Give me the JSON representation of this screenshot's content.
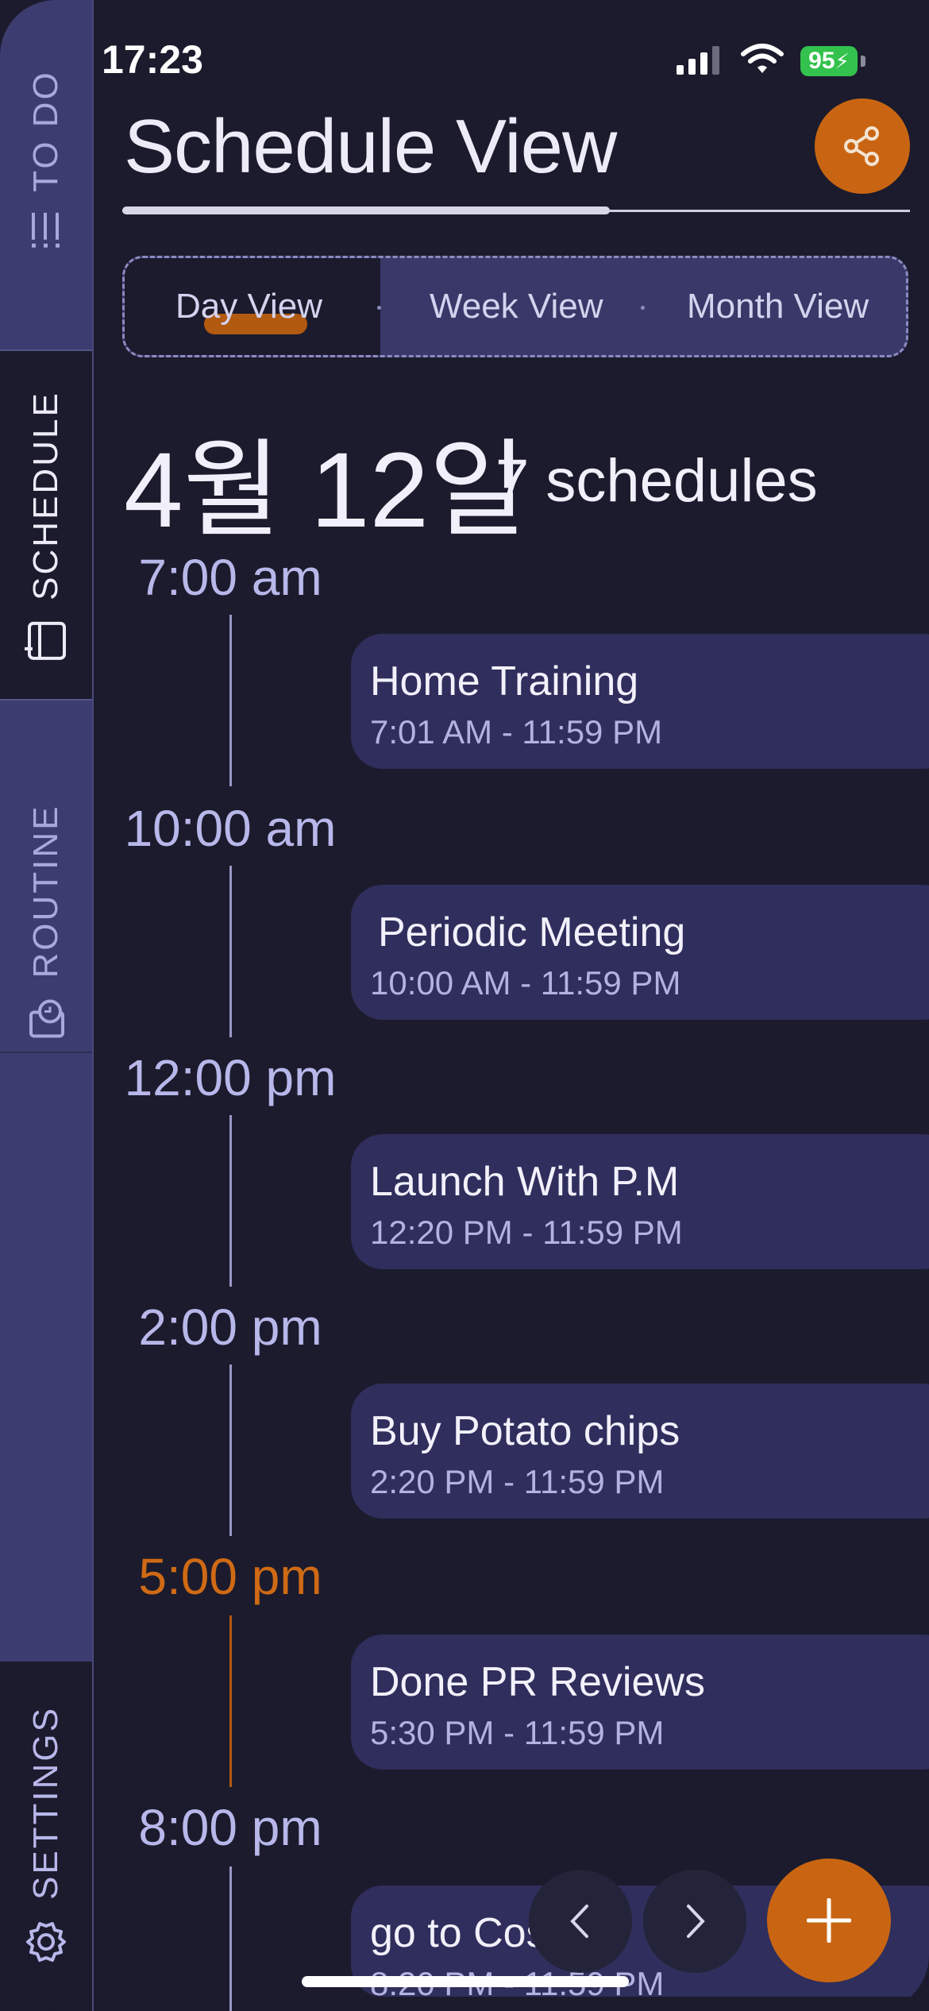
{
  "status": {
    "time": "17:23",
    "battery": "95"
  },
  "sidebar": {
    "todo": {
      "label": "TO DO",
      "icon": "list-icon"
    },
    "schedule": {
      "label": "SCHEDULE",
      "icon": "calendar-icon"
    },
    "routine": {
      "label": "ROUTINE",
      "icon": "routine-clock-icon"
    },
    "settings": {
      "label": "SETTINGS",
      "icon": "gear-icon"
    }
  },
  "header": {
    "title": "Schedule View",
    "share_icon": "share-icon"
  },
  "views": {
    "day": "Day View",
    "week": "Week View",
    "month": "Month View",
    "selected": "Day View"
  },
  "date": {
    "label": "4월 12일",
    "count": "7 schedules"
  },
  "timeline": [
    {
      "time": "7:00 am",
      "title": "Home Training",
      "range": "7:01 AM - 11:59 PM"
    },
    {
      "time": "10:00 am",
      "title": "Periodic Meeting",
      "range": "10:00 AM - 11:59 PM"
    },
    {
      "time": "12:00 pm",
      "title": "Launch With P.M",
      "range": "12:20 PM - 11:59 PM"
    },
    {
      "time": "2:00 pm",
      "title": "Buy Potato chips",
      "range": "2:20 PM - 11:59 PM"
    },
    {
      "time": "5:00 pm",
      "title": "Done PR Reviews",
      "range": "5:30 PM - 11:59 PM",
      "current": true
    },
    {
      "time": "8:00 pm",
      "title": "go to Cos",
      "range": "8:20 PM - 11:59 PM"
    }
  ],
  "colors": {
    "accent": "#c96512",
    "background": "#1b1b2d",
    "card": "#2f2e5c",
    "time_text": "#b8b7ea"
  },
  "controls": {
    "prev_icon": "chevron-left-icon",
    "next_icon": "chevron-right-icon",
    "add_icon": "plus-icon"
  }
}
